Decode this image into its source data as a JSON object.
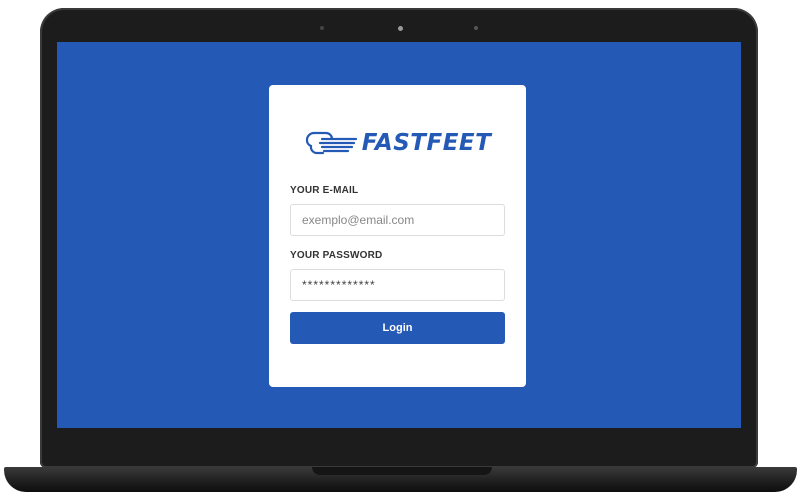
{
  "brand": {
    "name": "FASTFEET",
    "icon": "fast-delivery-box-icon",
    "color": "#2459b6"
  },
  "form": {
    "email_label": "YOUR E-MAIL",
    "email_placeholder": "exemplo@email.com",
    "password_label": "YOUR PASSWORD",
    "password_value": "*************",
    "login_label": "Login"
  },
  "colors": {
    "screen_background": "#2459b6",
    "card_background": "#ffffff",
    "button_background": "#2459b6",
    "laptop_frame": "#1c1c1c"
  }
}
